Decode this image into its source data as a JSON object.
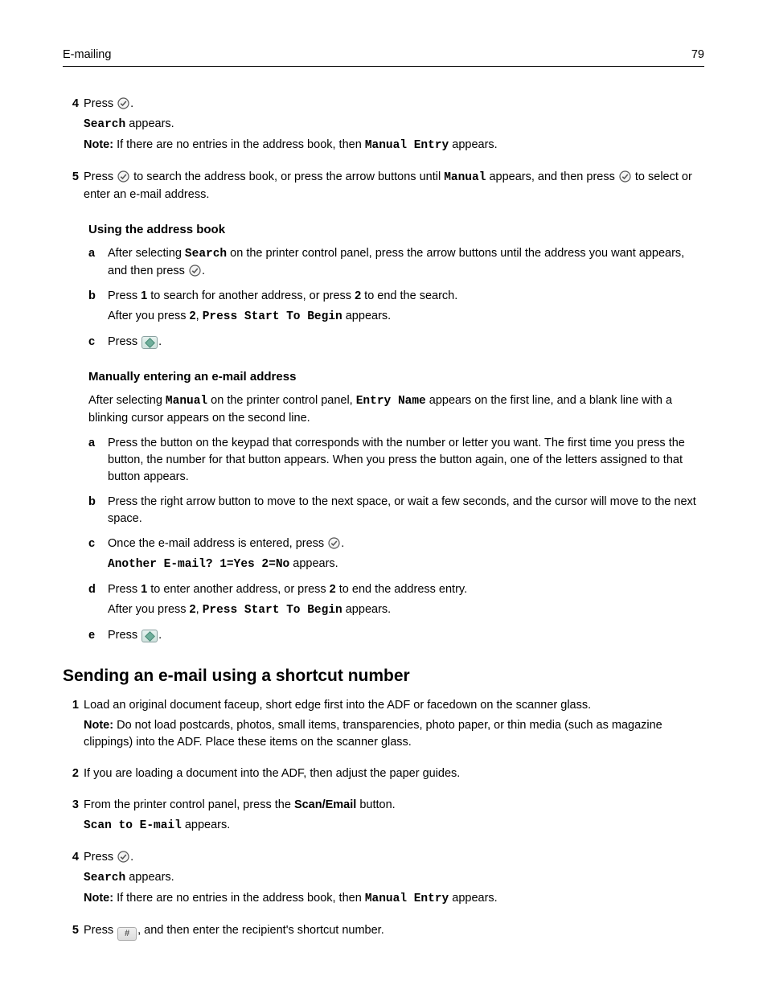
{
  "header": {
    "left": "E-mailing",
    "right": "79"
  },
  "step4": {
    "prefix": "Press ",
    "suffix": ".",
    "line2a": "Search",
    "line2b": " appears.",
    "note_label": "Note:",
    "note_text": " If there are no entries in the address book, then ",
    "note_mono": "Manual Entry",
    "note_after": " appears."
  },
  "step5": {
    "p1": "Press ",
    "p2": " to search the address book, or press the arrow buttons until ",
    "p_mono": "Manual",
    "p3": " appears, and then press ",
    "p4": " to select or enter an e-mail address."
  },
  "using_head": "Using the address book",
  "ua": {
    "p1": "After selecting ",
    "m1": "Search",
    "p2": " on the printer control panel, press the arrow buttons until the address you want appears, and then press ",
    "p3": "."
  },
  "ub": {
    "p1": "Press ",
    "b1": "1",
    "p2": " to search for another address, or press ",
    "b2": "2",
    "p3": " to end the search.",
    "q1": "After you press ",
    "qb": "2",
    "q2": ", ",
    "qm": "Press Start To Begin",
    "q3": " appears."
  },
  "uc": {
    "p1": "Press ",
    "p2": "."
  },
  "manual_head": "Manually entering an e-mail address",
  "manual_intro": {
    "p1": "After selecting ",
    "m1": "Manual",
    "p2": " on the printer control panel, ",
    "m2": "Entry Name",
    "p3": " appears on the first line, and a blank line with a blinking cursor appears on the second line."
  },
  "ma": "Press the button on the keypad that corresponds with the number or letter you want. The first time you press the button, the number for that button appears. When you press the button again, one of the letters assigned to that button appears.",
  "mb": "Press the right arrow button to move to the next space, or wait a few seconds, and the cursor will move to the next space.",
  "mc": {
    "p1": "Once the e-mail address is entered, press ",
    "p2": ".",
    "m1": "Another E-mail? 1=Yes 2=No",
    "p3": " appears."
  },
  "md": {
    "p1": "Press ",
    "b1": "1",
    "p2": " to enter another address, or press ",
    "b2": "2",
    "p3": " to end the address entry.",
    "q1": "After you press ",
    "qb": "2",
    "q2": ", ",
    "qm": "Press Start To Begin",
    "q3": " appears."
  },
  "me": {
    "p1": "Press ",
    "p2": "."
  },
  "section2_head": "Sending an e-mail using a shortcut number",
  "s1": {
    "p1": "Load an original document faceup, short edge first into the ADF or facedown on the scanner glass.",
    "note_label": "Note:",
    "note_text": " Do not load postcards, photos, small items, transparencies, photo paper, or thin media (such as magazine clippings) into the ADF. Place these items on the scanner glass."
  },
  "s2": "If you are loading a document into the ADF, then adjust the paper guides.",
  "s3": {
    "p1": "From the printer control panel, press the ",
    "b1": "Scan/Email",
    "p2": " button.",
    "m1": "Scan to E-mail",
    "p3": " appears."
  },
  "s4": {
    "prefix": "Press ",
    "suffix": ".",
    "line2a": "Search",
    "line2b": " appears.",
    "note_label": "Note:",
    "note_text": " If there are no entries in the address book, then ",
    "note_mono": "Manual Entry",
    "note_after": " appears."
  },
  "s5": {
    "p1": "Press ",
    "p2": ", and then enter the recipient's shortcut number."
  },
  "hash_glyph": "#"
}
